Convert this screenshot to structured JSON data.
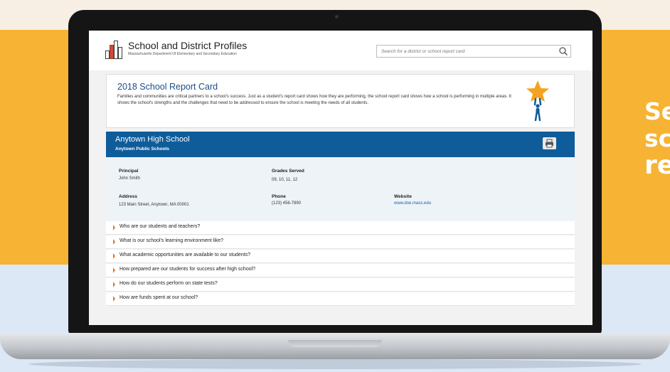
{
  "promo": {
    "lines": [
      "Se",
      "sc",
      "re"
    ]
  },
  "site": {
    "title": "School and District Profiles",
    "subtitle": "Massachusetts Department Of Elementary and Secondary Education",
    "search_placeholder": "Search for a district or school report card"
  },
  "intro": {
    "title": "2018 School Report Card",
    "body": "Families and communities are critical partners to a school's success. Just as a student's report card shows how they are performing, the school report card shows how a school is performing in multiple areas. It shows the school's strengths and the challenges that need to be addressed to ensure the school is meeting the needs of all students."
  },
  "school": {
    "name": "Anytown High School",
    "district": "Anytown Public Schools",
    "principal_label": "Principal",
    "principal": "John Smith",
    "grades_label": "Grades Served",
    "grades": "09, 10, 11, 12",
    "address_label": "Address",
    "address": "123 Main Street, Anytown, MA 00001",
    "phone_label": "Phone",
    "phone": "(123) 456-7890",
    "website_label": "Website",
    "website": "www.doe.mass.edu"
  },
  "sections": [
    "Who are our students and teachers?",
    "What is our school's learning environment like?",
    "What academic opportunities are available to our students?",
    "How prepared are our students for success after high school?",
    "How do our students perform on state tests?",
    "How are funds spent at our school?"
  ],
  "colors": {
    "brand_blue": "#0f5c9a",
    "accent_orange": "#e87722",
    "promo_orange": "#f7b334"
  },
  "icons": {
    "search": "search-icon",
    "print": "print-icon",
    "star": "star-person-icon"
  }
}
